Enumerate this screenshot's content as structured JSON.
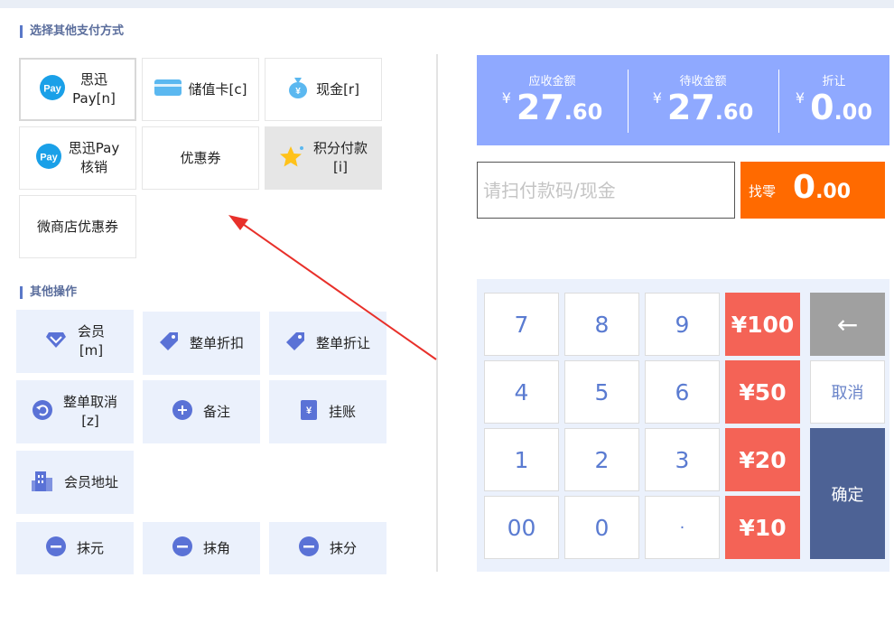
{
  "payment_section": {
    "title": "选择其他支付方式",
    "methods": [
      {
        "label_line1": "思迅",
        "label_line2": "Pay[n]",
        "icon": "pay-circle-icon"
      },
      {
        "label_line1": "储值卡[c]",
        "label_line2": "",
        "icon": "card-icon"
      },
      {
        "label_line1": "现金[r]",
        "label_line2": "",
        "icon": "money-bag-icon"
      },
      {
        "label_line1": "思迅Pay",
        "label_line2": "核销",
        "icon": "pay-circle-icon"
      },
      {
        "label_line1": "优惠券",
        "label_line2": "",
        "icon": ""
      },
      {
        "label_line1": "积分付款",
        "label_line2": "[i]",
        "icon": "star-icon"
      },
      {
        "label_line1": "微商店优惠券",
        "label_line2": "",
        "icon": ""
      }
    ]
  },
  "operations_section": {
    "title": "其他操作",
    "ops": [
      {
        "label_line1": "会员",
        "label_line2": "[m]",
        "icon": "diamond-icon"
      },
      {
        "label_line1": "整单折扣",
        "label_line2": "",
        "icon": "tag-icon"
      },
      {
        "label_line1": "整单折让",
        "label_line2": "",
        "icon": "tag-icon"
      },
      {
        "label_line1": "整单取消",
        "label_line2": "[z]",
        "icon": "undo-icon"
      },
      {
        "label_line1": "备注",
        "label_line2": "",
        "icon": "plus-circle-icon"
      },
      {
        "label_line1": "挂账",
        "label_line2": "",
        "icon": "yen-doc-icon"
      },
      {
        "label_line1": "会员地址",
        "label_line2": "",
        "icon": "building-icon"
      },
      {
        "label_line1": "抹元",
        "label_line2": "",
        "icon": "minus-circle-icon"
      },
      {
        "label_line1": "抹角",
        "label_line2": "",
        "icon": "minus-circle-icon"
      },
      {
        "label_line1": "抹分",
        "label_line2": "",
        "icon": "minus-circle-icon"
      }
    ]
  },
  "summary": {
    "receivable": {
      "label": "应收金额",
      "currency": "¥",
      "integer": "27",
      "decimal": ".60"
    },
    "pending": {
      "label": "待收金额",
      "currency": "¥",
      "integer": "27",
      "decimal": ".60"
    },
    "discount": {
      "label": "折让",
      "currency": "¥",
      "integer": "0",
      "decimal": ".00"
    }
  },
  "scan": {
    "placeholder": "请扫付款码/现金"
  },
  "change": {
    "label": "找零",
    "integer": "0",
    "decimal": ".00"
  },
  "keypad": {
    "k7": "7",
    "k8": "8",
    "k9": "9",
    "q100": "¥100",
    "backspace": "←",
    "k4": "4",
    "k5": "5",
    "k6": "6",
    "q50": "¥50",
    "cancel": "取消",
    "k1": "1",
    "k2": "2",
    "k3": "3",
    "q20": "¥20",
    "confirm": "确定",
    "k00": "00",
    "k0": "0",
    "kdot": "·",
    "q10": "¥10"
  },
  "colors": {
    "summary_bg": "#8fa9ff",
    "change_bg": "#ff6a00",
    "quick_amount_bg": "#f46356",
    "confirm_bg": "#4d6295",
    "backspace_bg": "#a0a0a0",
    "op_bg": "#ebf1fc",
    "annotation_arrow": "#e8302a"
  }
}
